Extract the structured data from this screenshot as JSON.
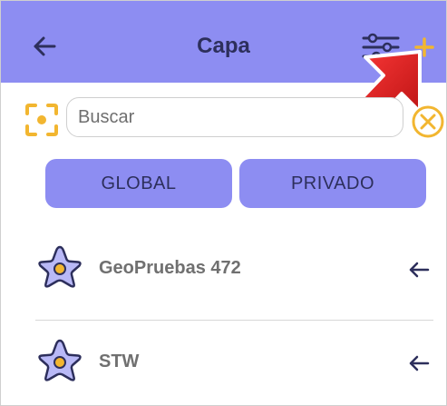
{
  "appbar": {
    "title": "Capa",
    "back_icon": "arrow-left-icon",
    "filter_icon": "sliders-icon",
    "add_icon": "plus-icon",
    "background_color": "#8d8df2"
  },
  "search": {
    "placeholder": "Buscar",
    "value": "",
    "scan_icon": "scan-target-icon",
    "clear_icon": "clear-circle-icon"
  },
  "tabs": [
    {
      "label": "GLOBAL"
    },
    {
      "label": "PRIVADO"
    }
  ],
  "layers": [
    {
      "name": "GeoPruebas 472",
      "icon": "star-icon",
      "action_icon": "arrow-left-icon"
    },
    {
      "name": "STW",
      "icon": "star-icon",
      "action_icon": "arrow-left-icon"
    }
  ],
  "colors": {
    "accent": "#8d8df2",
    "title_text": "#2d2f5c",
    "icon_yellow": "#f2b630",
    "annotation_red": "#d61f1f"
  }
}
